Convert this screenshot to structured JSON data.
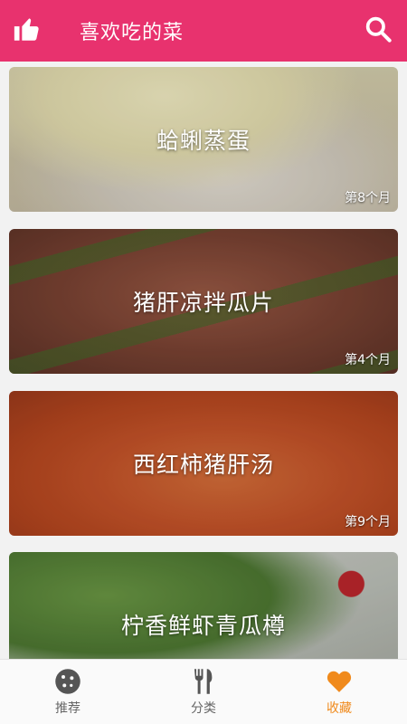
{
  "header": {
    "title": "喜欢吃的菜"
  },
  "cards": [
    {
      "name": "蛤蜊蒸蛋",
      "month": "第8个月"
    },
    {
      "name": "猪肝凉拌瓜片",
      "month": "第4个月"
    },
    {
      "name": "西红柿猪肝汤",
      "month": "第9个月"
    },
    {
      "name": "柠香鲜虾青瓜樽",
      "month": ""
    }
  ],
  "tabs": [
    {
      "label": "推荐",
      "icon": "cookie-icon"
    },
    {
      "label": "分类",
      "icon": "utensils-icon"
    },
    {
      "label": "收藏",
      "icon": "heart-icon"
    }
  ],
  "colors": {
    "accent": "#e8326e",
    "active_tab": "#f08a1c"
  }
}
